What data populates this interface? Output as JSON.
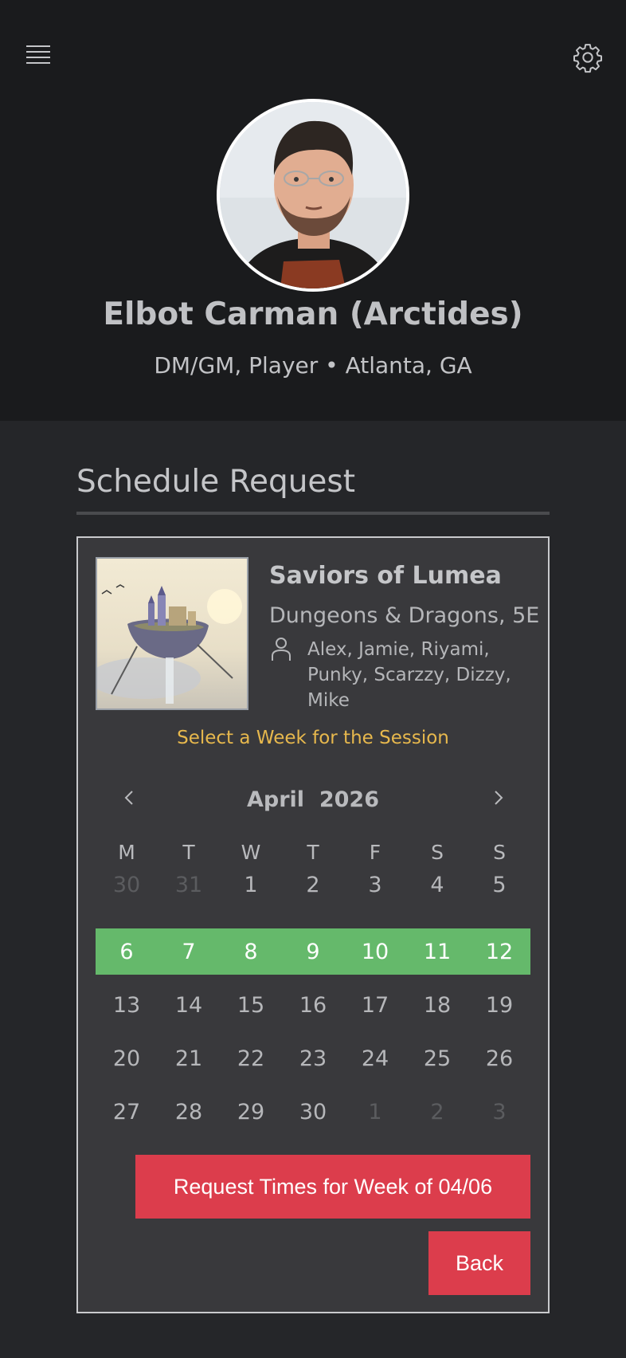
{
  "header": {
    "menu_icon": "hamburger-menu-icon",
    "settings_icon": "gear-icon"
  },
  "profile": {
    "name": "Elbot Carman (Arctides)",
    "subtitle": "DM/GM, Player • Atlanta, GA"
  },
  "section": {
    "title": "Schedule Request"
  },
  "game": {
    "title": "Saviors of Lumea",
    "system": "Dungeons & Dragons, 5E",
    "players_icon": "person-icon",
    "players": "Alex, Jamie, Riyami, Punky, Scarzzy, Dizzy, Mike"
  },
  "calendar": {
    "hint": "Select a Week for the Session",
    "month_label": "April  2026",
    "prev_icon": "chevron-left-icon",
    "next_icon": "chevron-right-icon",
    "weekdays": [
      "M",
      "T",
      "W",
      "T",
      "F",
      "S",
      "S"
    ],
    "weeks": [
      [
        "30",
        "31",
        "1",
        "2",
        "3",
        "4",
        "5"
      ],
      [
        "6",
        "7",
        "8",
        "9",
        "10",
        "11",
        "12"
      ],
      [
        "13",
        "14",
        "15",
        "16",
        "17",
        "18",
        "19"
      ],
      [
        "20",
        "21",
        "22",
        "23",
        "24",
        "25",
        "26"
      ],
      [
        "27",
        "28",
        "29",
        "30",
        "1",
        "2",
        "3"
      ]
    ],
    "selected_week_index": 1,
    "selected_color": "#65b96b"
  },
  "actions": {
    "request_label": "Request Times for Week of 04/06",
    "back_label": "Back",
    "button_color": "#dc3d4c"
  },
  "colors": {
    "hint": "#e7b84d",
    "header_bg": "#1a1b1d",
    "card_bg": "#39393c"
  }
}
